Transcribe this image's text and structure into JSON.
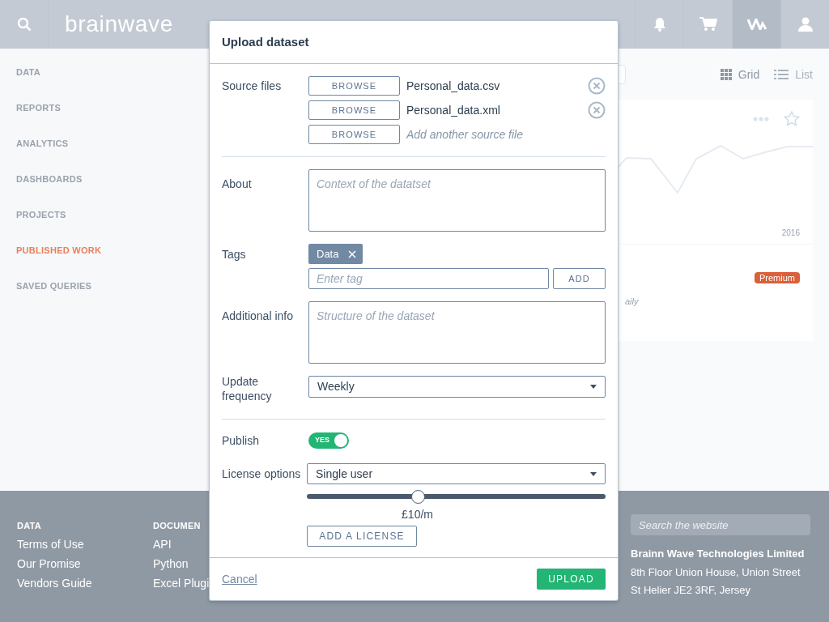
{
  "header": {
    "logo": "brainwave",
    "icons": [
      {
        "kind": "bell",
        "selected": false
      },
      {
        "kind": "cart",
        "selected": false
      },
      {
        "kind": "wave",
        "selected": true
      },
      {
        "kind": "user",
        "selected": false
      }
    ]
  },
  "sidebar": {
    "items": [
      {
        "label": "DATA",
        "selected": false
      },
      {
        "label": "REPORTS",
        "selected": false
      },
      {
        "label": "ANALYTICS",
        "selected": false
      },
      {
        "label": "DASHBOARDS",
        "selected": false
      },
      {
        "label": "PROJECTS",
        "selected": false
      },
      {
        "label": "PUBLISHED WORK",
        "selected": true
      },
      {
        "label": "SAVED QUERIES",
        "selected": false
      }
    ]
  },
  "view_toggle": [
    {
      "label": "Grid",
      "selected": true
    },
    {
      "label": "List",
      "selected": false
    }
  ],
  "card": {
    "x_label": "2016",
    "badge": "Premium",
    "frequency": "aily"
  },
  "footer": {
    "columns": [
      {
        "heading": "DATA",
        "links": [
          "Terms of Use",
          "Our Promise",
          "Vendors Guide"
        ]
      },
      {
        "heading": "DOCUMEN",
        "links": [
          "API",
          "Python",
          "Excel Plugi"
        ]
      }
    ],
    "search": {
      "placeholder": "Search the website"
    },
    "company": "Brainn Wave Technologies Limited",
    "address": [
      "8th Floor Union House, Union Street",
      "St Helier JE2 3RF, Jersey"
    ]
  },
  "modal": {
    "title": "Upload dataset",
    "source_files": {
      "label": "Source files",
      "rows": [
        {
          "button": "BROWSE",
          "file": "Personal_data.csv"
        },
        {
          "button": "BROWSE",
          "file": "Personal_data.xml"
        },
        {
          "button": "BROWSE",
          "placeholder": "Add another source file"
        }
      ]
    },
    "about": {
      "label": "About",
      "placeholder": "Context of the datatset"
    },
    "tags": {
      "label": "Tags",
      "items": [
        {
          "label": "Data"
        }
      ],
      "placeholder": "Enter tag",
      "add_button": "ADD"
    },
    "additional_info": {
      "label": "Additional info",
      "placeholder": "Structure of the dataset"
    },
    "update_frequency": {
      "label": "Update frequency",
      "value": "Weekly"
    },
    "publish": {
      "label": "Publish",
      "on": true,
      "on_label": "YES"
    },
    "license": {
      "label": "License options",
      "value": "Single user",
      "level": 0.37,
      "reading": "£10/m",
      "add_button": "ADD A LICENSE"
    },
    "cancel": "Cancel",
    "upload": "UPLOAD"
  }
}
